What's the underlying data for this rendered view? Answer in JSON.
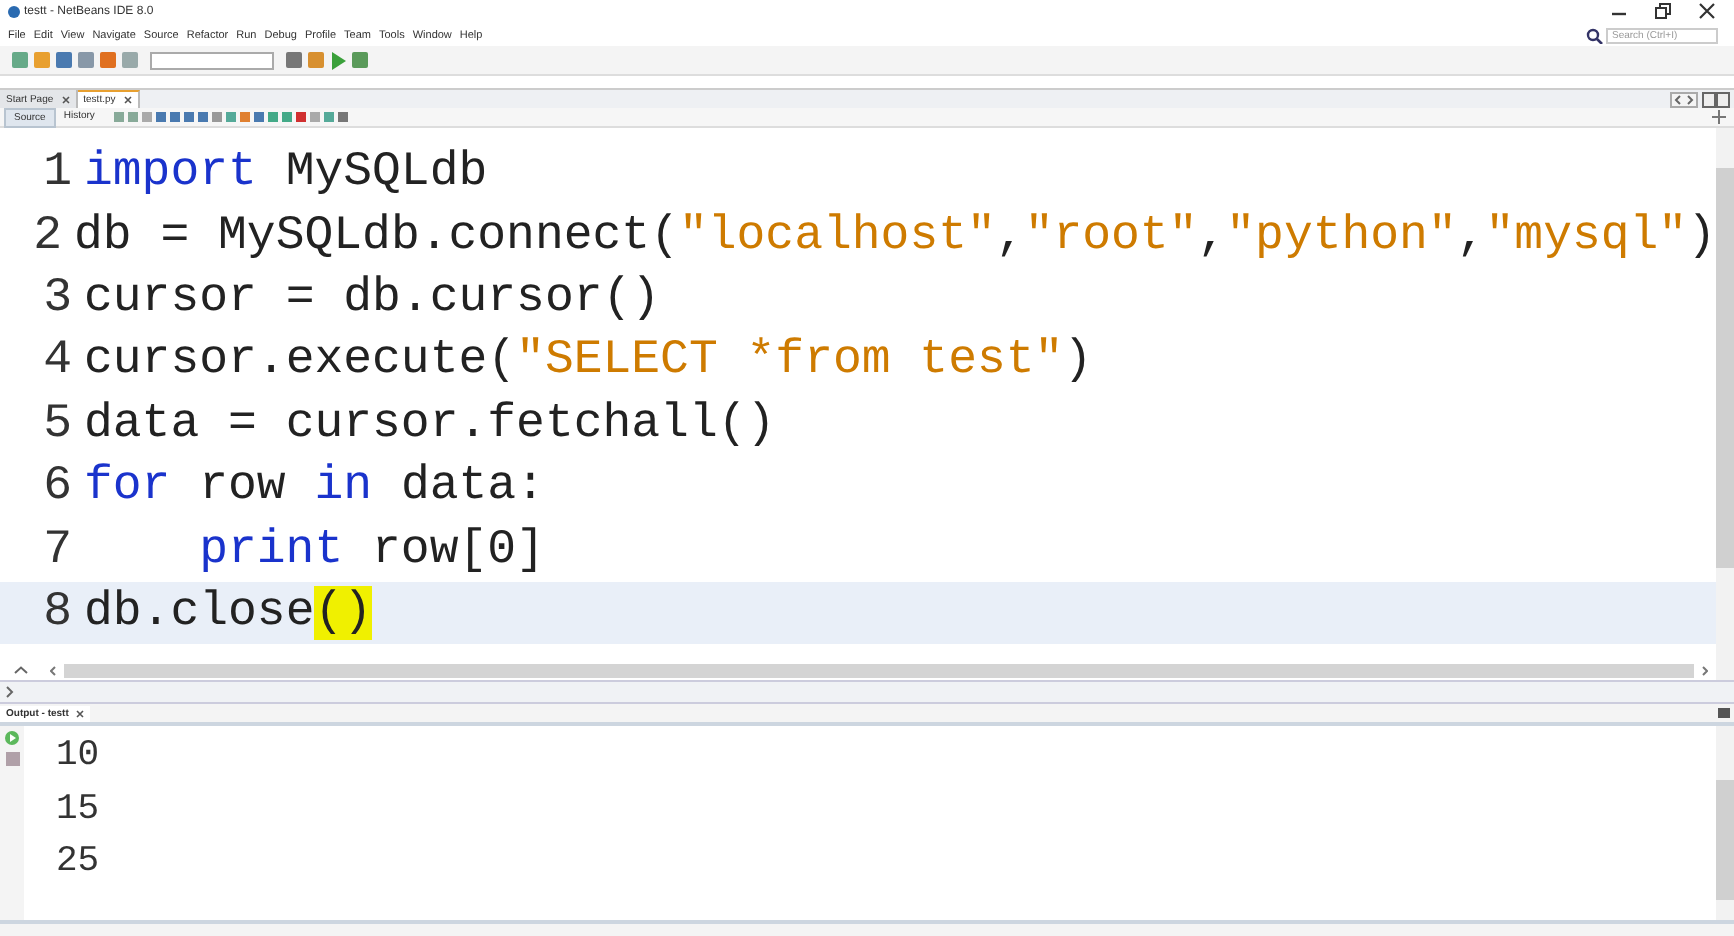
{
  "window": {
    "title": "testt - NetBeans IDE 8.0"
  },
  "menu": [
    "File",
    "Edit",
    "View",
    "Navigate",
    "Source",
    "Refactor",
    "Run",
    "Debug",
    "Profile",
    "Team",
    "Tools",
    "Window",
    "Help"
  ],
  "search": {
    "placeholder": "Search (Ctrl+I)"
  },
  "tabs": [
    {
      "label": "Start Page",
      "selected": false
    },
    {
      "label": "testt.py",
      "selected": true
    }
  ],
  "editor_tabs": [
    {
      "label": "Source",
      "selected": true
    },
    {
      "label": "History",
      "selected": false
    }
  ],
  "code_lines": [
    {
      "number": "1",
      "current": false,
      "indented": false,
      "tokens": [
        {
          "kind": "keyword",
          "text": "import"
        },
        {
          "kind": "plain",
          "text": " MySQLdb"
        }
      ]
    },
    {
      "number": "2",
      "current": false,
      "indented": false,
      "tokens": [
        {
          "kind": "plain",
          "text": "db = MySQLdb.connect("
        },
        {
          "kind": "string",
          "text": "\"localhost\""
        },
        {
          "kind": "plain",
          "text": ","
        },
        {
          "kind": "string",
          "text": "\"root\""
        },
        {
          "kind": "plain",
          "text": ","
        },
        {
          "kind": "string",
          "text": "\"python\""
        },
        {
          "kind": "plain",
          "text": ","
        },
        {
          "kind": "string",
          "text": "\"mysql\""
        },
        {
          "kind": "plain",
          "text": ")"
        }
      ]
    },
    {
      "number": "3",
      "current": false,
      "indented": false,
      "tokens": [
        {
          "kind": "plain",
          "text": "cursor = db.cursor()"
        }
      ]
    },
    {
      "number": "4",
      "current": false,
      "indented": false,
      "tokens": [
        {
          "kind": "plain",
          "text": "cursor.execute("
        },
        {
          "kind": "string",
          "text": "\"SELECT *from test\""
        },
        {
          "kind": "plain",
          "text": ")"
        }
      ]
    },
    {
      "number": "5",
      "current": false,
      "indented": false,
      "tokens": [
        {
          "kind": "plain",
          "text": "data = cursor.fetchall()"
        }
      ]
    },
    {
      "number": "6",
      "current": false,
      "indented": false,
      "tokens": [
        {
          "kind": "keyword",
          "text": "for"
        },
        {
          "kind": "plain",
          "text": " row "
        },
        {
          "kind": "keyword",
          "text": "in"
        },
        {
          "kind": "plain",
          "text": " data:"
        }
      ]
    },
    {
      "number": "7",
      "current": false,
      "indented": true,
      "tokens": [
        {
          "kind": "keyword",
          "text": "print"
        },
        {
          "kind": "plain",
          "text": " row[0]"
        }
      ]
    },
    {
      "number": "8",
      "current": true,
      "indented": false,
      "tokens": [
        {
          "kind": "plain",
          "text": "db.close"
        },
        {
          "kind": "match",
          "text": "()"
        }
      ]
    }
  ],
  "output": {
    "title": "Output - testt",
    "lines": [
      "10",
      "15",
      "25"
    ]
  }
}
